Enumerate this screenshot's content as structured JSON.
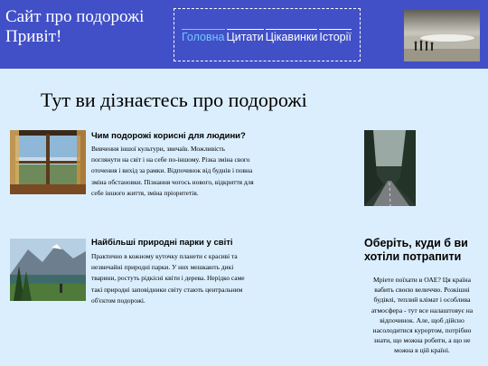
{
  "header": {
    "site_title": "Сайт про подорожі Привіт!",
    "nav": [
      {
        "label": "Головна",
        "active": true
      },
      {
        "label": "Цитати",
        "active": false
      },
      {
        "label": "Цікавинки",
        "active": false
      },
      {
        "label": "Історії",
        "active": false
      }
    ]
  },
  "main": {
    "heading": "Тут ви дізнаєтесь про подорожі",
    "articles": [
      {
        "title": "Чим подорожі корисні для людини?",
        "text": "Вивчення іншої культури, звичаїв. Можливість поглянути на світ і на себе по-іншому. Різка зміна свого оточення і вихід за рамки. Відпочинок від буднів і повна зміна обстановки. Пізнання чогось нового, відкриття для себе іншого життя, зміна пріоритетів."
      },
      {
        "title": "Найбільші природні парки у світі",
        "text": "Практично в кожному куточку планети є красиві та незвичайні природні парки. У них мешкають дикі тварини, ростуть рідкісні квіти і дерева. Нерідко саме такі природні заповідники світу стають центральним об'єктом подорожі."
      }
    ]
  },
  "aside": {
    "title": "Оберіть, куди б ви хотіли потрапити",
    "text": "Мріете поїхати в ОАЕ? Ця країна вабить своєю величчю. Розкішні будівлі, теплий клімат і особлива атмосфера - тут все налаштовує на відпочинок. Але, щоб дійсно насолодитися курортом, потрібно знати, що можна робити, а що не можна в цій країні."
  },
  "colors": {
    "header_bg": "#4150c7",
    "page_bg": "#dbeefd",
    "nav_active": "#74c6ff"
  }
}
